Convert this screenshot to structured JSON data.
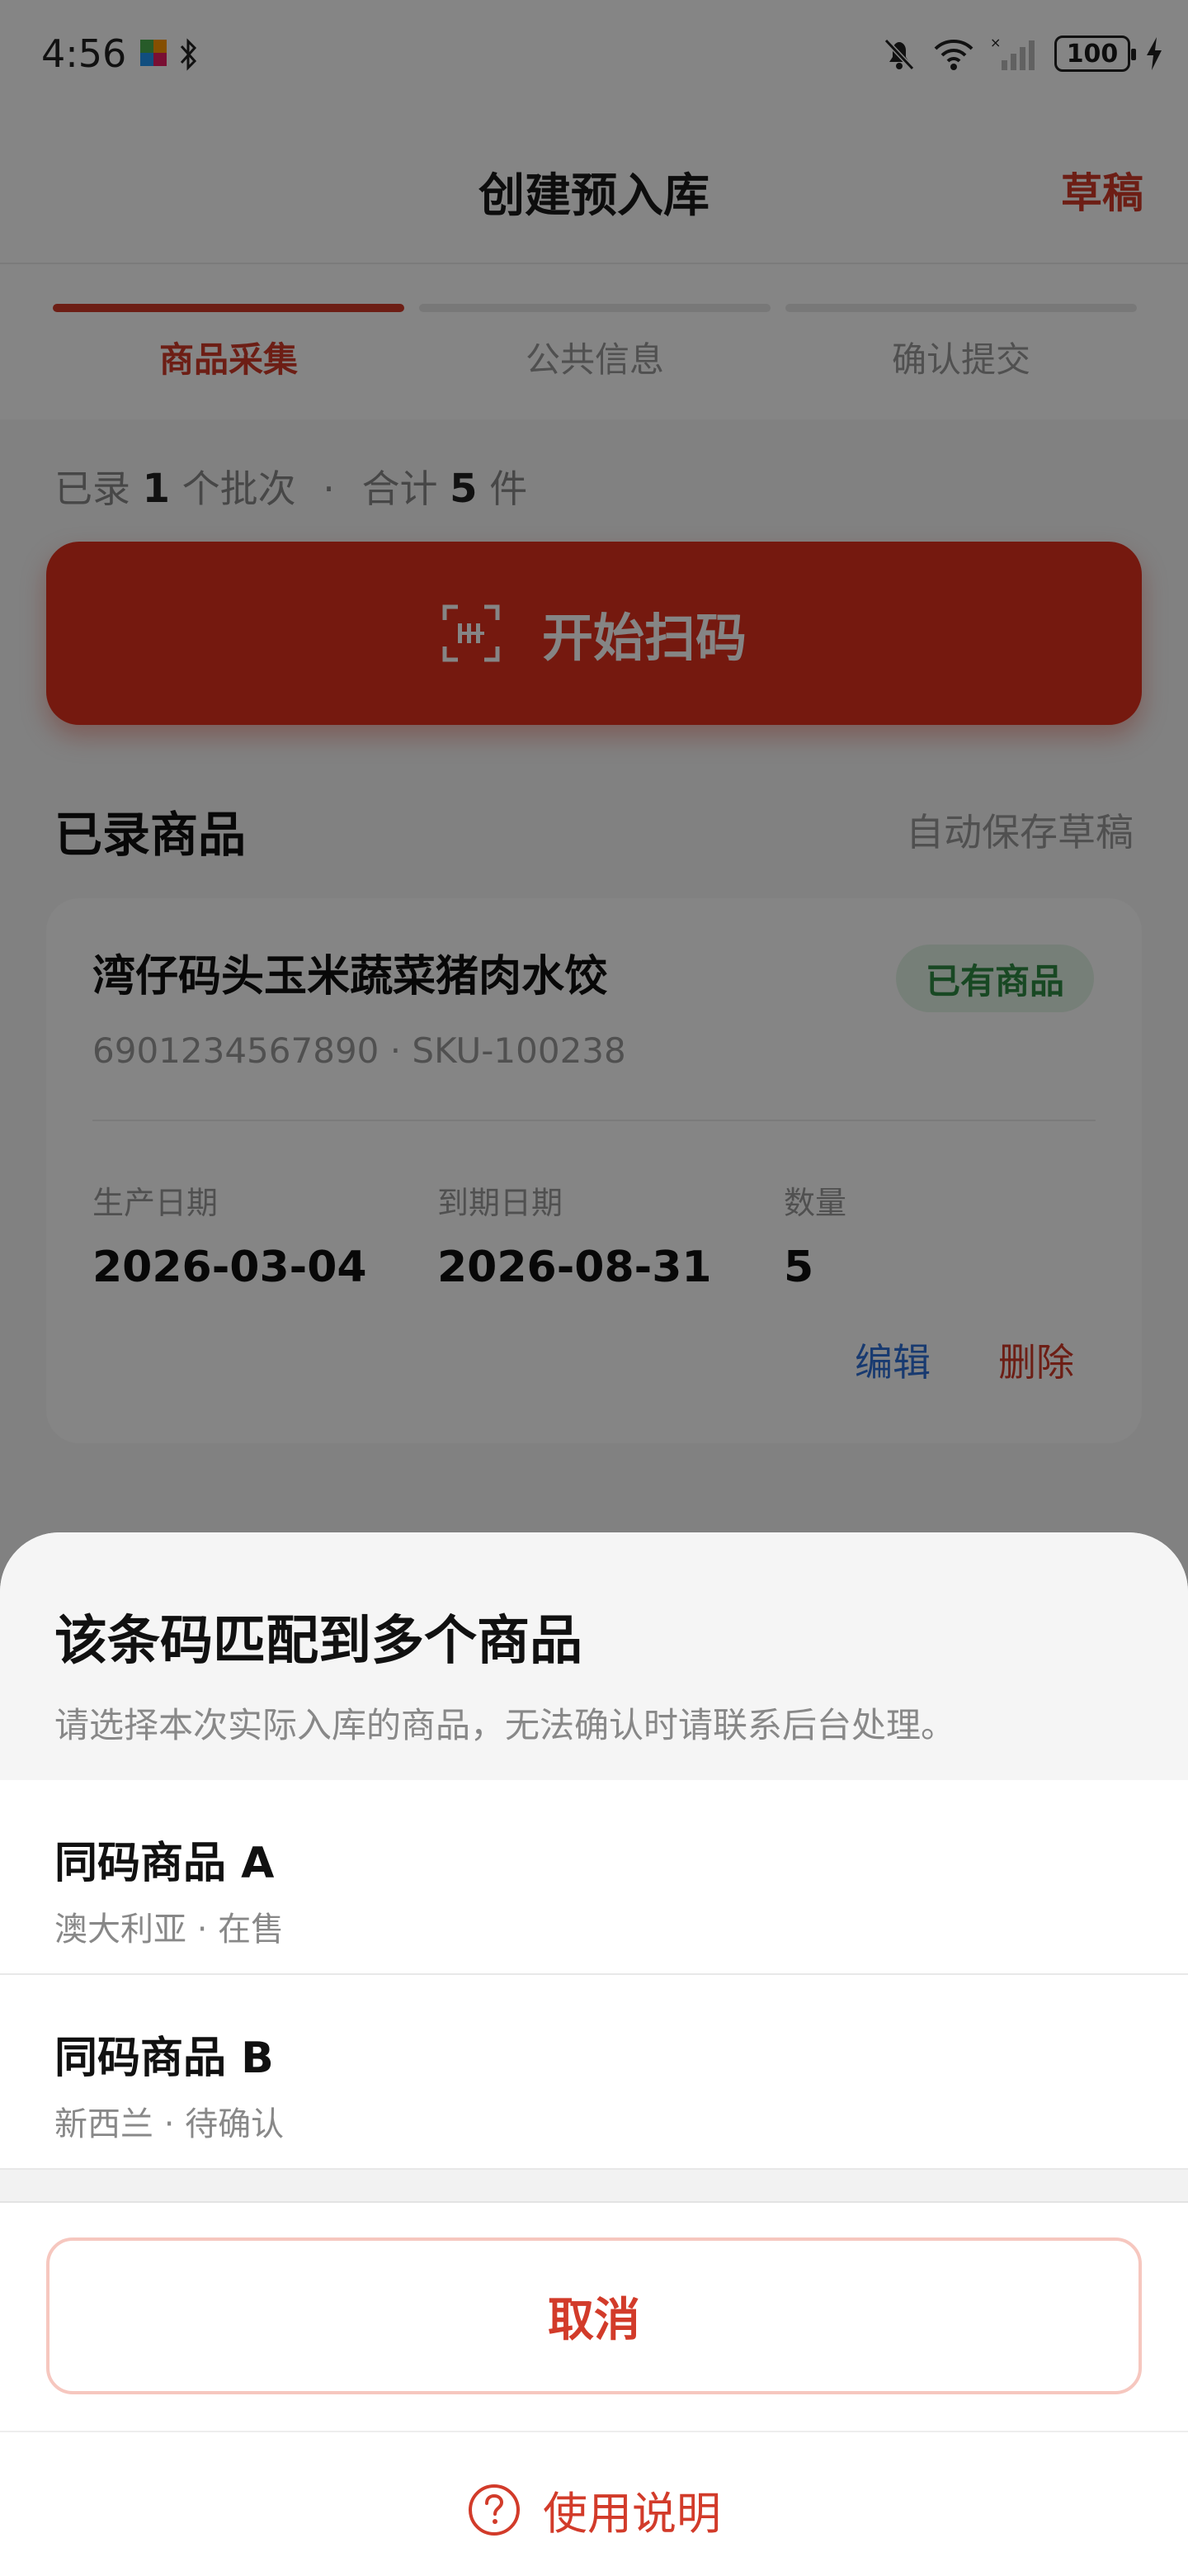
{
  "status_bar": {
    "time": "4:56",
    "battery": "100"
  },
  "header": {
    "title": "创建预入库",
    "draft_label": "草稿"
  },
  "steps": [
    {
      "label": "商品采集",
      "active": true
    },
    {
      "label": "公共信息",
      "active": false
    },
    {
      "label": "确认提交",
      "active": false
    }
  ],
  "summary": {
    "prefix": "已录",
    "batches": "1",
    "batch_unit": "个批次",
    "dot": "·",
    "total_prefix": "合计",
    "total": "5",
    "total_unit": "件"
  },
  "scan_button": {
    "label": "开始扫码"
  },
  "recorded": {
    "title": "已录商品",
    "autosave": "自动保存草稿"
  },
  "product": {
    "name": "湾仔码头玉米蔬菜猪肉水饺",
    "badge": "已有商品",
    "code": "6901234567890 · SKU-100238",
    "production_label": "生产日期",
    "production_date": "2026-03-04",
    "expiry_label": "到期日期",
    "expiry_date": "2026-08-31",
    "quantity_label": "数量",
    "quantity": "5",
    "edit_label": "编辑",
    "delete_label": "删除"
  },
  "sheet": {
    "title": "该条码匹配到多个商品",
    "subtitle": "请选择本次实际入库的商品，无法确认时请联系后台处理。",
    "options": [
      {
        "title": "同码商品 A",
        "meta": "澳大利亚 · 在售"
      },
      {
        "title": "同码商品 B",
        "meta": "新西兰 · 待确认"
      }
    ],
    "cancel_label": "取消",
    "help_label": "使用说明"
  },
  "colors": {
    "accent": "#d23b2a",
    "scan_button": "#e0301e",
    "badge_text": "#2e8b44",
    "badge_bg": "#e3f4e6",
    "link_blue": "#2f6fd6"
  },
  "icons": [
    "app-colorful-icon",
    "bluetooth-icon",
    "mute-bell-icon",
    "wifi-icon",
    "signal-icon",
    "battery-icon",
    "charging-icon",
    "scan-icon",
    "help-circle-icon"
  ]
}
